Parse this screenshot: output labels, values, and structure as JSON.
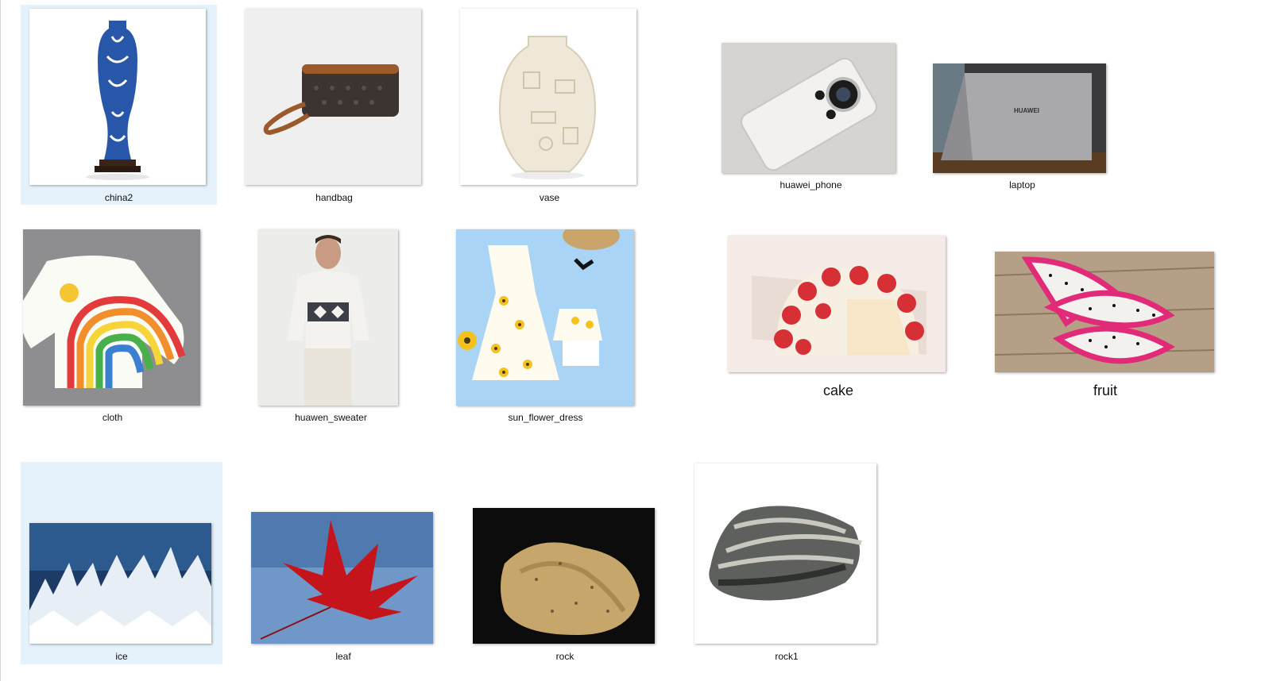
{
  "colors": {
    "selection": "#e5f1fb",
    "background": "#ffffff"
  },
  "files": [
    {
      "name": "china2",
      "thumbnail": "blue-white-porcelain-vase-image",
      "selected": true
    },
    {
      "name": "handbag",
      "thumbnail": "brown-clutch-handbag-image",
      "selected": false
    },
    {
      "name": "vase",
      "thumbnail": "white-clay-vase-image",
      "selected": false
    },
    {
      "name": "huawei_phone",
      "thumbnail": "white-smartphone-image",
      "selected": false
    },
    {
      "name": "laptop",
      "thumbnail": "huawei-laptop-image",
      "selected": false
    },
    {
      "name": "cloth",
      "thumbnail": "rainbow-sweater-image",
      "selected": false
    },
    {
      "name": "huawen_sweater",
      "thumbnail": "man-in-patterned-sweater-image",
      "selected": false
    },
    {
      "name": "sun_flower_dress",
      "thumbnail": "sunflower-dress-image",
      "selected": false
    },
    {
      "name": "cake",
      "thumbnail": "strawberry-cake-image",
      "selected": false
    },
    {
      "name": "fruit",
      "thumbnail": "dragon-fruit-image",
      "selected": false
    },
    {
      "name": "ice",
      "thumbnail": "ice-crystals-image",
      "selected": true
    },
    {
      "name": "leaf",
      "thumbnail": "red-maple-leaf-image",
      "selected": false
    },
    {
      "name": "rock",
      "thumbnail": "yellow-granite-rock-image",
      "selected": false
    },
    {
      "name": "rock1",
      "thumbnail": "striped-gray-rock-image",
      "selected": false
    }
  ],
  "thumbnail_text": {
    "laptop_brand": "HUAWEI"
  }
}
